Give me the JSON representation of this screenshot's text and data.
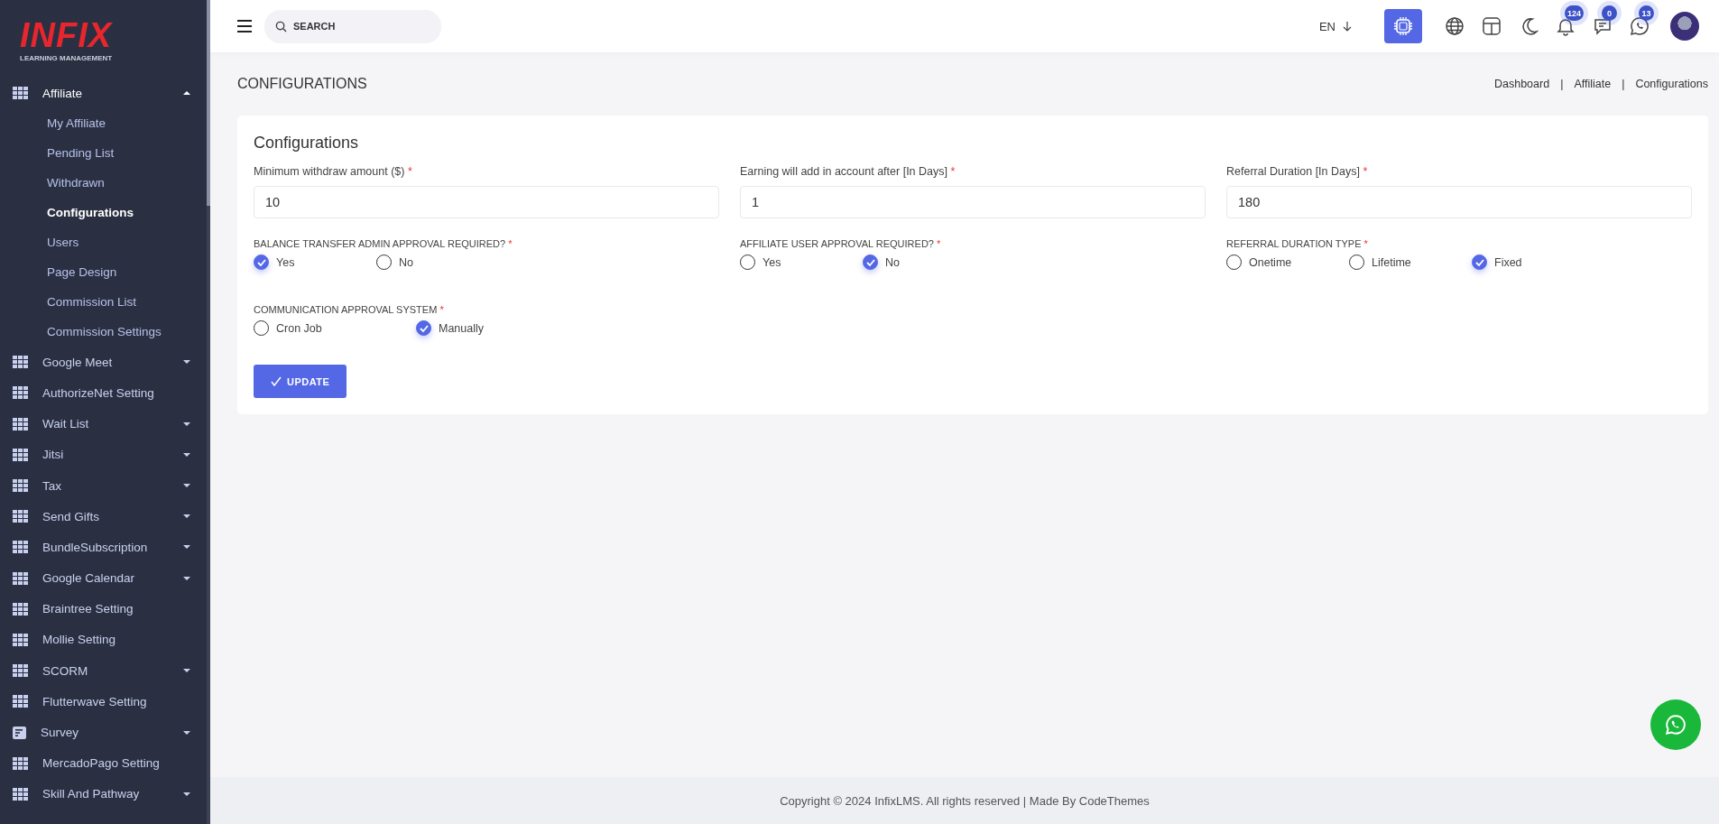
{
  "sidebar": {
    "logo": {
      "title": "INFIX",
      "subtitle": "LEARNING MANAGEMENT"
    },
    "items": [
      {
        "label": "Affiliate",
        "kind": "group",
        "expanded": true,
        "children": [
          {
            "label": "My Affiliate",
            "selected": false
          },
          {
            "label": "Pending List",
            "selected": false
          },
          {
            "label": "Withdrawn",
            "selected": false
          },
          {
            "label": "Configurations",
            "selected": true
          },
          {
            "label": "Users",
            "selected": false
          },
          {
            "label": "Page Design",
            "selected": false
          },
          {
            "label": "Commission List",
            "selected": false
          },
          {
            "label": "Commission Settings",
            "selected": false
          }
        ]
      },
      {
        "label": "Google Meet",
        "kind": "group",
        "expanded": false
      },
      {
        "label": "AuthorizeNet Setting",
        "kind": "link"
      },
      {
        "label": "Wait List",
        "kind": "group",
        "expanded": false
      },
      {
        "label": "Jitsi",
        "kind": "group",
        "expanded": false
      },
      {
        "label": "Tax",
        "kind": "group",
        "expanded": false
      },
      {
        "label": "Send Gifts",
        "kind": "group",
        "expanded": false
      },
      {
        "label": "BundleSubscription",
        "kind": "group",
        "expanded": false
      },
      {
        "label": "Google Calendar",
        "kind": "group",
        "expanded": false
      },
      {
        "label": "Braintree Setting",
        "kind": "link"
      },
      {
        "label": "Mollie Setting",
        "kind": "link"
      },
      {
        "label": "SCORM",
        "kind": "group",
        "expanded": false
      },
      {
        "label": "Flutterwave Setting",
        "kind": "link"
      },
      {
        "label": "Survey",
        "kind": "form",
        "expanded": false
      },
      {
        "label": "MercadoPago Setting",
        "kind": "link"
      },
      {
        "label": "Skill And Pathway",
        "kind": "group",
        "expanded": false
      }
    ]
  },
  "topbar": {
    "search": {
      "placeholder": "SEARCH"
    },
    "language": "EN",
    "icons": [
      {
        "kind": "ai"
      },
      {
        "kind": "globe"
      },
      {
        "kind": "layout"
      },
      {
        "kind": "moon"
      },
      {
        "kind": "bell",
        "badge": "124"
      },
      {
        "kind": "chat",
        "badge": "0"
      },
      {
        "kind": "whatsapp",
        "badge": "13"
      },
      {
        "kind": "avatar"
      }
    ]
  },
  "page": {
    "title": "CONFIGURATIONS",
    "breadcrumb": [
      {
        "text": "Dashboard",
        "separator": "|"
      },
      {
        "text": "Affiliate",
        "separator": "|"
      },
      {
        "text": "Configurations"
      }
    ]
  },
  "card": {
    "title": "Configurations",
    "fields": [
      {
        "label": "Minimum withdraw amount ($)",
        "required_mark": "*",
        "value": "10"
      },
      {
        "label": "Earning will add in account after [In Days]",
        "required_mark": "*",
        "value": "1"
      },
      {
        "label": "Referral Duration [In Days]",
        "required_mark": "*",
        "value": "180"
      }
    ],
    "radio_groups": [
      {
        "label": "BALANCE TRANSFER ADMIN APPROVAL REQUIRED?",
        "required_mark": "*",
        "options": [
          {
            "label": "Yes",
            "selected": true
          },
          {
            "label": "No",
            "selected": false
          }
        ]
      },
      {
        "label": "AFFILIATE USER APPROVAL REQUIRED?",
        "required_mark": "*",
        "options": [
          {
            "label": "Yes",
            "selected": false
          },
          {
            "label": "No",
            "selected": true
          }
        ]
      },
      {
        "label": "REFERRAL DURATION TYPE",
        "required_mark": "*",
        "options": [
          {
            "label": "Onetime",
            "selected": false
          },
          {
            "label": "Lifetime",
            "selected": false
          },
          {
            "label": "Fixed",
            "selected": true
          }
        ]
      },
      {
        "label": "COMMUNICATION APPROVAL SYSTEM",
        "required_mark": "*",
        "options": [
          {
            "label": "Cron Job",
            "selected": false
          },
          {
            "label": "Manually",
            "selected": true
          }
        ]
      }
    ],
    "button": "UPDATE"
  },
  "footer": "Copyright © 2024 InfixLMS. All rights reserved | Made By CodeThemes"
}
